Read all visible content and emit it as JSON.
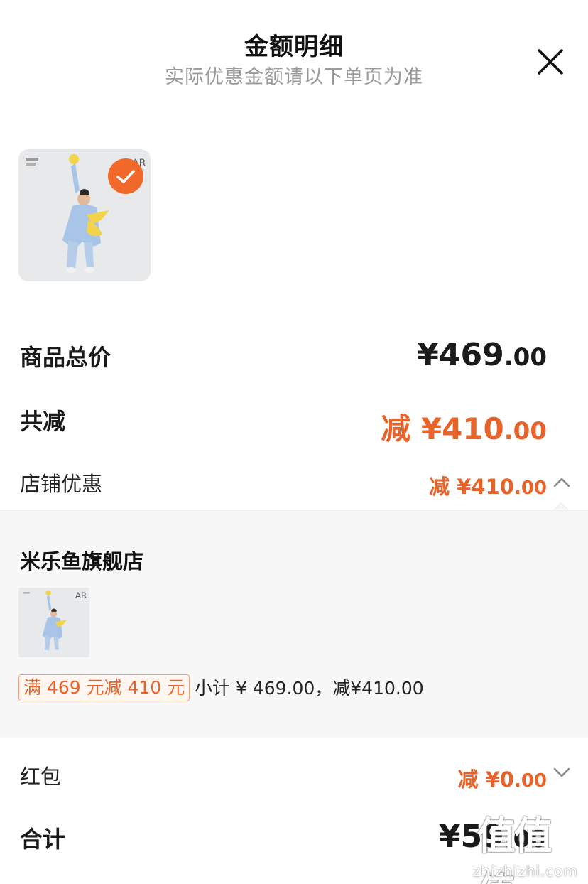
{
  "header": {
    "title": "金额明细",
    "subtitle": "实际优惠金额请以下单页为准"
  },
  "summary": {
    "total_price": {
      "label": "商品总价",
      "currency": "¥",
      "int": "469",
      "cents": ".00"
    },
    "discount": {
      "label": "共减",
      "prefix": "减 ¥",
      "int": "410",
      "cents": ".00"
    },
    "store_discount": {
      "label": "店铺优惠",
      "prefix": "减 ¥",
      "int": "410",
      "cents": ".00"
    }
  },
  "store": {
    "name": "米乐鱼旗舰店",
    "promo_tag": "满 469 元减 410 元",
    "subtotal": "小计 ¥ 469.00，减¥410.00"
  },
  "redpack": {
    "label": "红包",
    "prefix": "减 ¥",
    "int": "0",
    "cents": ".00"
  },
  "total": {
    "label": "合计",
    "currency": "¥",
    "int": "59",
    "cents": ".00"
  },
  "watermark": {
    "logo": "值值值",
    "site": "zhizhizhi.com"
  },
  "colors": {
    "accent": "#e8632a",
    "check_badge": "#f0682a",
    "panel_bg": "#f7f7f7"
  },
  "icons": [
    "close-icon",
    "check-icon",
    "chevron-up-icon",
    "chevron-down-icon"
  ]
}
